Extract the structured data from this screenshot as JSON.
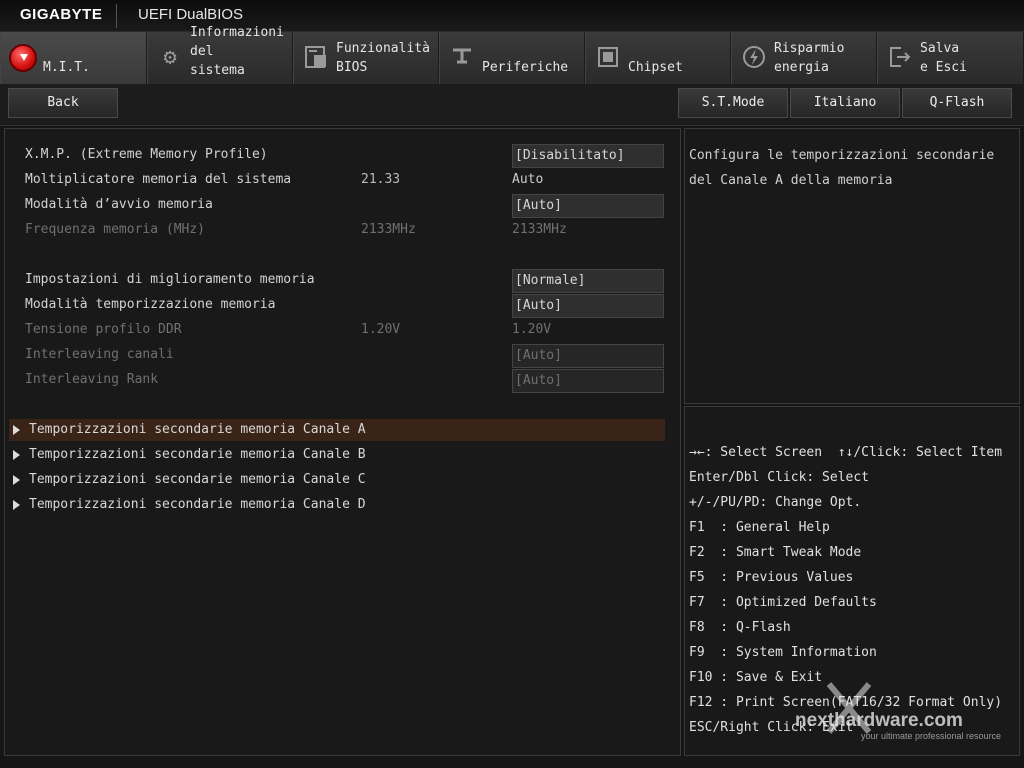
{
  "titlebar": {
    "brand": "GIGABYTE",
    "product": "UEFI DualBIOS"
  },
  "tabs": [
    {
      "label": "M.I.T.",
      "icon": "mit-icon"
    },
    {
      "label": "Informazioni\ndel\nsistema",
      "icon": "gear-icon"
    },
    {
      "label": "Funzionalità\nBIOS",
      "icon": "chip-board-icon"
    },
    {
      "label": "Periferiche",
      "icon": "periferiche-icon"
    },
    {
      "label": "Chipset",
      "icon": "chipset-icon"
    },
    {
      "label": "Risparmio\nenergia",
      "icon": "power-saving-icon"
    },
    {
      "label": "Salva\ne Esci",
      "icon": "exit-icon"
    }
  ],
  "nav": {
    "back": "Back",
    "stmode": "S.T.Mode",
    "language": "Italiano",
    "qflash": "Q-Flash"
  },
  "settings": [
    {
      "label": "X.M.P. (Extreme Memory Profile)",
      "mid": "",
      "value": "[Disabilitato]",
      "boxed": true,
      "dim": false
    },
    {
      "label": "Moltiplicatore memoria del sistema",
      "mid": "21.33",
      "value": "Auto",
      "boxed": false,
      "dim": false
    },
    {
      "label": "Modalità d’avvio memoria",
      "mid": "",
      "value": "[Auto]",
      "boxed": true,
      "dim": false
    },
    {
      "label": "Frequenza memoria (MHz)",
      "mid": "2133MHz",
      "value": "2133MHz",
      "boxed": false,
      "dim": true
    },
    {
      "label": "Impostazioni di miglioramento memoria",
      "mid": "",
      "value": "[Normale]",
      "boxed": true,
      "dim": false
    },
    {
      "label": "Modalità temporizzazione memoria",
      "mid": "",
      "value": "[Auto]",
      "boxed": true,
      "dim": false
    },
    {
      "label": "Tensione profilo DDR",
      "mid": "1.20V",
      "value": "1.20V",
      "boxed": false,
      "dim": true
    },
    {
      "label": "Interleaving canali",
      "mid": "",
      "value": "[Auto]",
      "boxed": true,
      "dim": true
    },
    {
      "label": "Interleaving Rank",
      "mid": "",
      "value": "[Auto]",
      "boxed": true,
      "dim": true
    }
  ],
  "submenus": [
    "Temporizzazioni secondarie memoria Canale A",
    "Temporizzazioni secondarie memoria Canale B",
    "Temporizzazioni secondarie memoria Canale C",
    "Temporizzazioni secondarie memoria Canale D"
  ],
  "help": {
    "text": "Configura le temporizzazioni secondarie del Canale A della memoria"
  },
  "keys": [
    "→←: Select Screen  ↑↓/Click: Select Item",
    "Enter/Dbl Click: Select",
    "+/-/PU/PD: Change Opt.",
    "F1  : General Help",
    "F2  : Smart Tweak Mode",
    "F5  : Previous Values",
    "F7  : Optimized Defaults",
    "F8  : Q-Flash",
    "F9  : System Information",
    "F10 : Save & Exit",
    "F12 : Print Screen(FAT16/32 Format Only)",
    "ESC/Right Click: Exit"
  ],
  "watermark": {
    "brand": "nexthardware.com",
    "tagline": "your ultimate professional resource"
  },
  "colors": {
    "background": "#161616",
    "accent": "#d40f0f",
    "selected_row": "#3a2418"
  }
}
